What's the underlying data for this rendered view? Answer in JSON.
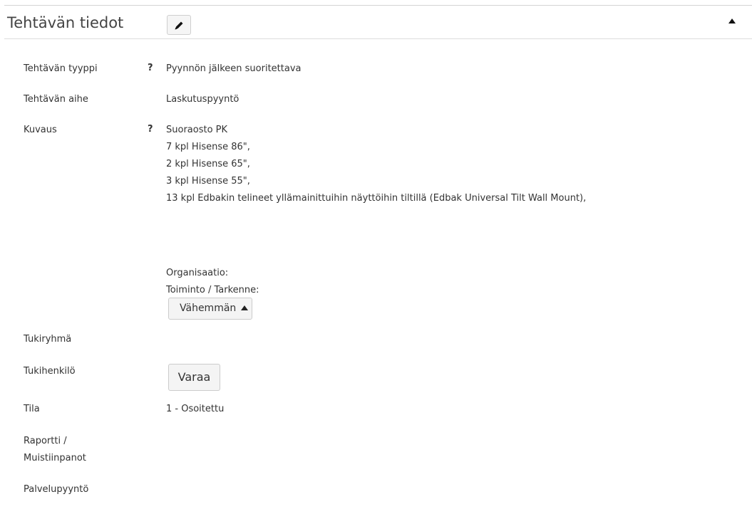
{
  "panel": {
    "title": "Tehtävän tiedot",
    "edit_icon": "pencil-icon",
    "collapse_icon": "caret-up-icon"
  },
  "fields": {
    "type": {
      "label": "Tehtävän tyyppi",
      "help": "?",
      "value": "Pyynnön jälkeen suoritettava"
    },
    "topic": {
      "label": "Tehtävän aihe",
      "value": "Laskutuspyyntö"
    },
    "description": {
      "label": "Kuvaus",
      "help": "?",
      "lines": [
        "Suoraosto PK",
        "7 kpl Hisense 86\",",
        "2 kpl Hisense 65\",",
        "3 kpl Hisense 55\",",
        "13 kpl Edbakin telineet yllämainittuihin näyttöihin tiltillä (Edbak Universal Tilt Wall Mount),"
      ],
      "organisation_label": "Organisaatio:",
      "function_label": "Toiminto / Tarkenne:",
      "less_button": "Vähemmän"
    },
    "support_group": {
      "label": "Tukiryhmä"
    },
    "support_person": {
      "label": "Tukihenkilö",
      "reserve_button": "Varaa"
    },
    "status": {
      "label": "Tila",
      "value": "1 - Osoitettu"
    },
    "report": {
      "label_line1": "Raportti /",
      "label_line2": "Muistiinpanot"
    },
    "service_request": {
      "label": "Palvelupyyntö"
    }
  }
}
